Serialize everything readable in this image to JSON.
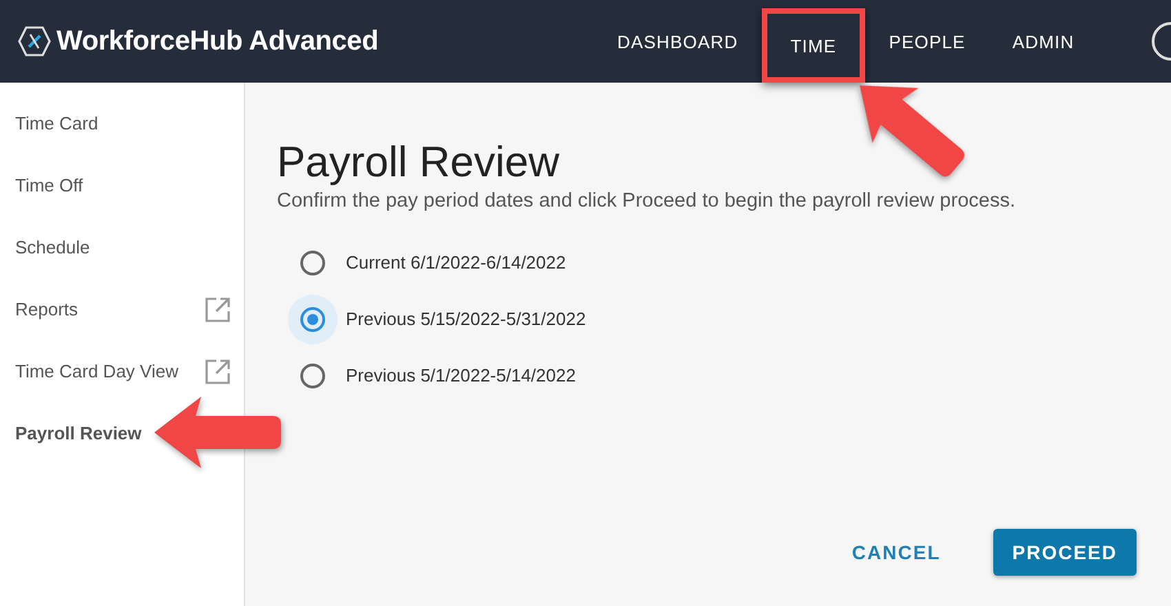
{
  "app": {
    "title": "WorkforceHub Advanced"
  },
  "nav": [
    {
      "label": "DASHBOARD",
      "highlighted": false
    },
    {
      "label": "TIME",
      "highlighted": true
    },
    {
      "label": "PEOPLE",
      "highlighted": false
    },
    {
      "label": "ADMIN",
      "highlighted": false
    }
  ],
  "sidebar": {
    "items": [
      {
        "label": "Time Card",
        "selected": false,
        "external": false,
        "callout": false
      },
      {
        "label": "Time Off",
        "selected": false,
        "external": false,
        "callout": false
      },
      {
        "label": "Schedule",
        "selected": false,
        "external": false,
        "callout": false
      },
      {
        "label": "Reports",
        "selected": false,
        "external": true,
        "callout": false
      },
      {
        "label": "Time Card Day View",
        "selected": false,
        "external": true,
        "callout": false
      },
      {
        "label": "Payroll Review",
        "selected": true,
        "external": false,
        "callout": true
      }
    ]
  },
  "page": {
    "title": "Payroll Review",
    "description": "Confirm the pay period dates and click Proceed to begin the payroll review process.",
    "options": [
      {
        "label": "Current 6/1/2022-6/14/2022",
        "selected": false
      },
      {
        "label": "Previous 5/15/2022-5/31/2022",
        "selected": true
      },
      {
        "label": "Previous 5/1/2022-5/14/2022",
        "selected": false
      }
    ],
    "buttons": [
      {
        "label": "CANCEL",
        "kind": "text"
      },
      {
        "label": "PROCEED",
        "kind": "primary"
      }
    ]
  }
}
